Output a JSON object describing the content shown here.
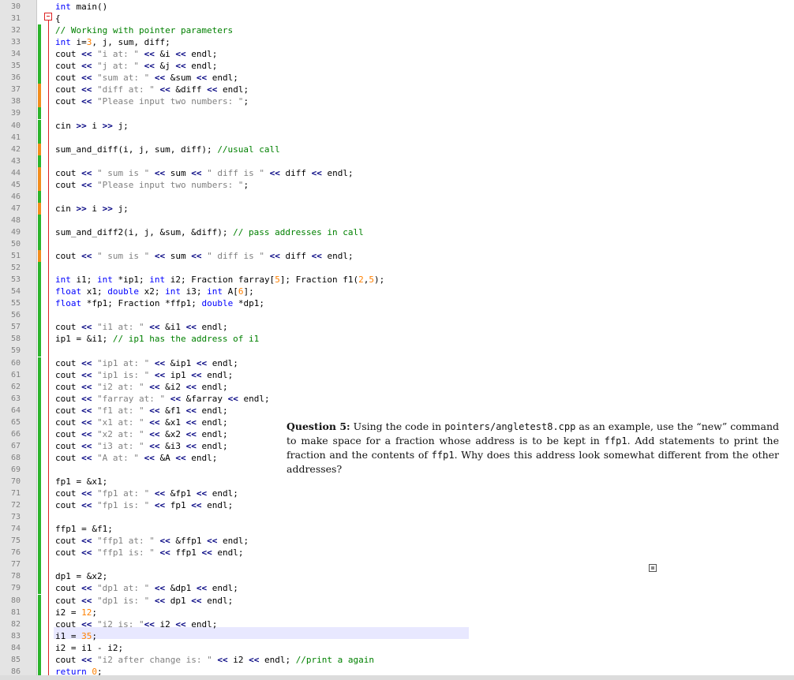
{
  "editor": {
    "lines": [
      {
        "n": "30",
        "text": "int main()",
        "mark": ""
      },
      {
        "n": "31",
        "text": "{",
        "mark": ""
      },
      {
        "n": "32",
        "text": "// Working with pointer parameters",
        "mark": "green"
      },
      {
        "n": "33",
        "text": "int i=3, j, sum, diff;",
        "mark": "green"
      },
      {
        "n": "34",
        "text": "cout << \"i at: \" << &i << endl;",
        "mark": "green"
      },
      {
        "n": "35",
        "text": "cout << \"j at: \" << &j << endl;",
        "mark": "green"
      },
      {
        "n": "36",
        "text": "cout << \"sum at: \" << &sum << endl;",
        "mark": "green"
      },
      {
        "n": "37",
        "text": "cout << \"diff at: \" << &diff << endl;",
        "mark": "orange"
      },
      {
        "n": "38",
        "text": "cout << \"Please input two numbers: \";",
        "mark": "orange"
      },
      {
        "n": "39",
        "text": "",
        "mark": "green"
      },
      {
        "n": "40",
        "text": "cin >> i >> j;",
        "mark": "green"
      },
      {
        "n": "41",
        "text": "",
        "mark": "green"
      },
      {
        "n": "42",
        "text": "sum_and_diff(i, j, sum, diff); //usual call",
        "mark": "orange"
      },
      {
        "n": "43",
        "text": "",
        "mark": "green"
      },
      {
        "n": "44",
        "text": "cout << \" sum is \" << sum << \" diff is \" << diff << endl;",
        "mark": "orange"
      },
      {
        "n": "45",
        "text": "cout << \"Please input two numbers: \";",
        "mark": "orange"
      },
      {
        "n": "46",
        "text": "",
        "mark": "green"
      },
      {
        "n": "47",
        "text": "cin >> i >> j;",
        "mark": "orange"
      },
      {
        "n": "48",
        "text": "",
        "mark": "green"
      },
      {
        "n": "49",
        "text": "sum_and_diff2(i, j, &sum, &diff); // pass addresses in call",
        "mark": "green"
      },
      {
        "n": "50",
        "text": "",
        "mark": "green"
      },
      {
        "n": "51",
        "text": "cout << \" sum is \" << sum << \" diff is \" << diff << endl;",
        "mark": "orange"
      },
      {
        "n": "52",
        "text": "",
        "mark": "green"
      },
      {
        "n": "53",
        "text": "int i1; int *ip1; int i2; Fraction farray[5]; Fraction f1(2,5);",
        "mark": "green"
      },
      {
        "n": "54",
        "text": "float x1; double x2; int i3; int A[6];",
        "mark": "green"
      },
      {
        "n": "55",
        "text": "float *fp1; Fraction *ffp1; double *dp1;",
        "mark": "green"
      },
      {
        "n": "56",
        "text": "",
        "mark": "green"
      },
      {
        "n": "57",
        "text": "cout << \"i1 at: \" << &i1 << endl;",
        "mark": "green"
      },
      {
        "n": "58",
        "text": "ip1 = &i1; // ip1 has the address of i1",
        "mark": "green"
      },
      {
        "n": "59",
        "text": "",
        "mark": "green"
      },
      {
        "n": "60",
        "text": "cout << \"ip1 at: \" << &ip1 << endl;",
        "mark": "green"
      },
      {
        "n": "61",
        "text": "cout << \"ip1 is: \" << ip1 << endl;",
        "mark": "green"
      },
      {
        "n": "62",
        "text": "cout << \"i2 at: \" << &i2 << endl;",
        "mark": "green"
      },
      {
        "n": "63",
        "text": "cout << \"farray at: \" << &farray << endl;",
        "mark": "green"
      },
      {
        "n": "64",
        "text": "cout << \"f1 at: \" << &f1 << endl;",
        "mark": "green"
      },
      {
        "n": "65",
        "text": "cout << \"x1 at: \" << &x1 << endl;",
        "mark": "green"
      },
      {
        "n": "66",
        "text": "cout << \"x2 at: \" << &x2 << endl;",
        "mark": "green"
      },
      {
        "n": "67",
        "text": "cout << \"i3 at: \" << &i3 << endl;",
        "mark": "green"
      },
      {
        "n": "68",
        "text": "cout << \"A at: \" << &A << endl;",
        "mark": "green"
      },
      {
        "n": "69",
        "text": "",
        "mark": "green"
      },
      {
        "n": "70",
        "text": "fp1 = &x1;",
        "mark": "green"
      },
      {
        "n": "71",
        "text": "cout << \"fp1 at: \" << &fp1 << endl;",
        "mark": "green"
      },
      {
        "n": "72",
        "text": "cout << \"fp1 is: \" << fp1 << endl;",
        "mark": "green"
      },
      {
        "n": "73",
        "text": "",
        "mark": "green"
      },
      {
        "n": "74",
        "text": "ffp1 = &f1;",
        "mark": "green"
      },
      {
        "n": "75",
        "text": "cout << \"ffp1 at: \" << &ffp1 << endl;",
        "mark": "green"
      },
      {
        "n": "76",
        "text": "cout << \"ffp1 is: \" << ffp1 << endl;",
        "mark": "green"
      },
      {
        "n": "77",
        "text": "",
        "mark": "green"
      },
      {
        "n": "78",
        "text": "dp1 = &x2;",
        "mark": "green"
      },
      {
        "n": "79",
        "text": "cout << \"dp1 at: \" << &dp1 << endl;",
        "mark": "green"
      },
      {
        "n": "80",
        "text": "cout << \"dp1 is: \" << dp1 << endl;",
        "mark": "green"
      },
      {
        "n": "81",
        "text": "i2 = 12;",
        "mark": "green"
      },
      {
        "n": "82",
        "text": "cout << \"i2 is: \"<< i2 << endl;",
        "mark": "green"
      },
      {
        "n": "83",
        "text": "i1 = 35;",
        "mark": "green"
      },
      {
        "n": "84",
        "text": "i2 = i1 - i2;",
        "mark": "green"
      },
      {
        "n": "85",
        "text": "cout << \"i2 after change is: \" << i2 << endl; //print a again",
        "mark": "green"
      },
      {
        "n": "86",
        "text": "return 0;",
        "mark": "green"
      }
    ]
  },
  "question": {
    "label": "Question 5:",
    "part1": " Using the code in ",
    "file": "pointers/angletest8.cpp",
    "part2": " as an example, use the “new” command to make space for a fraction whose address is to be kept in ",
    "var1": "ffp1",
    "part3": ". Add statements to print the fraction and the contents of ",
    "var2": "ffp1",
    "part4": ". Why does this address look somewhat different from the other addresses?"
  },
  "colors": {
    "keyword": "#0000ff",
    "number": "#ff8000",
    "string": "#808080",
    "comment": "#008000",
    "operator": "#000080",
    "change_saved": "#2bb32b",
    "change_unsaved": "#f28c1e"
  }
}
